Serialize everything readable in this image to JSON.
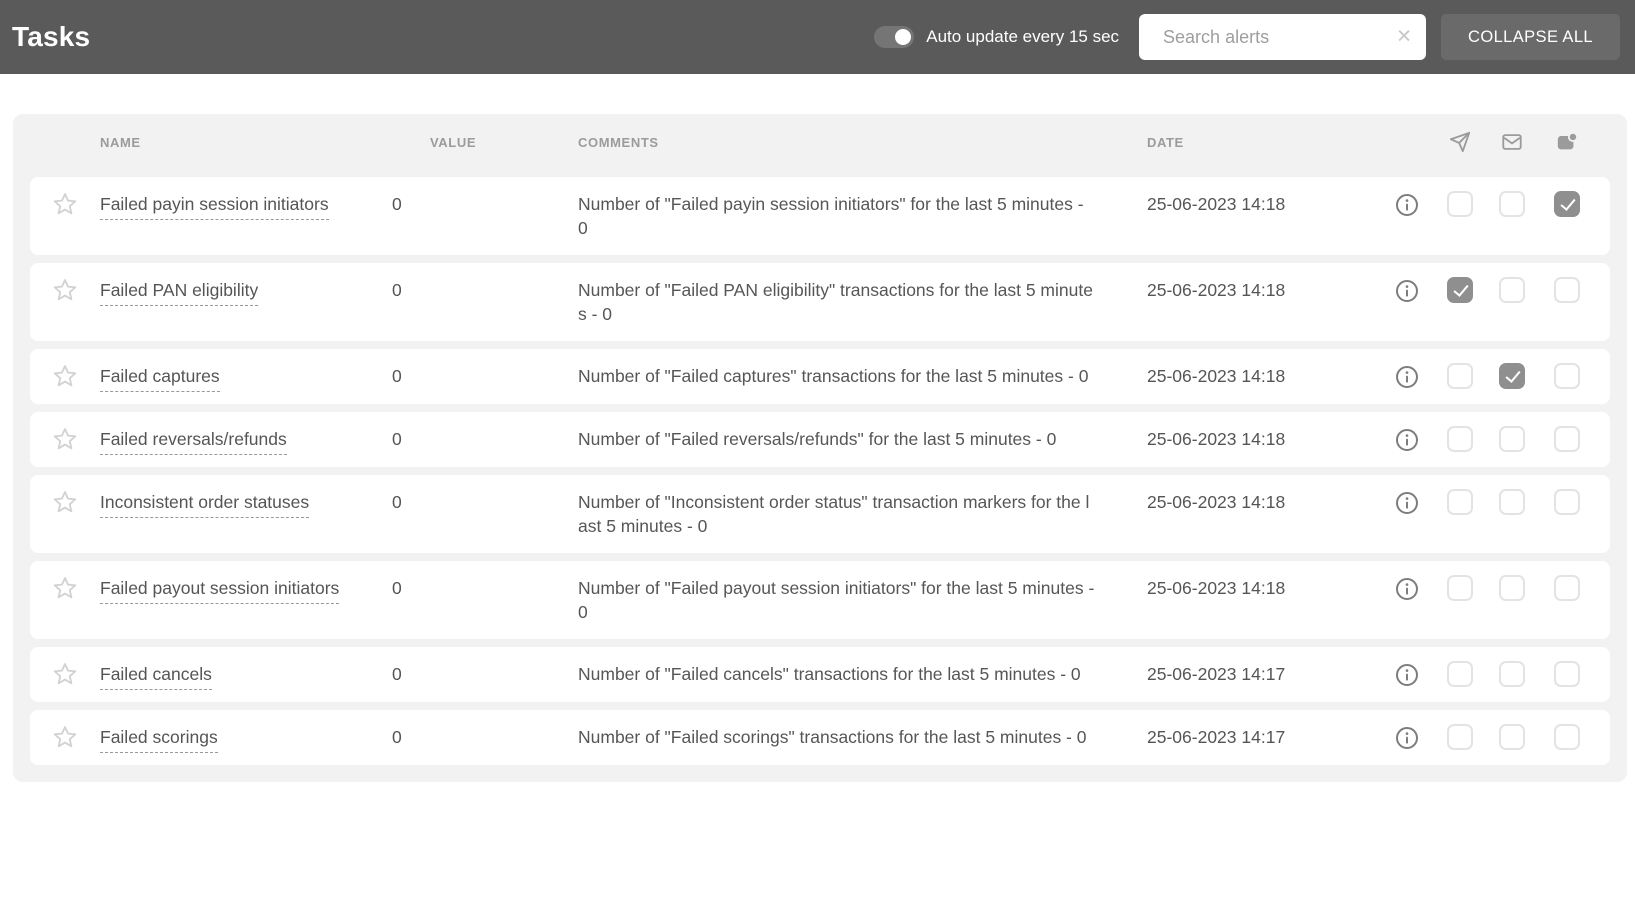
{
  "topbar": {
    "title": "Tasks",
    "auto_update": {
      "label": "Auto update every 15 sec",
      "enabled": true
    },
    "search": {
      "placeholder": "Search alerts",
      "value": "",
      "clear_icon": "✕"
    },
    "collapse_all_label": "COLLAPSE ALL"
  },
  "table": {
    "columns": {
      "name": "NAME",
      "value": "VALUE",
      "comments": "COMMENTS",
      "date": "DATE"
    },
    "channel_columns": [
      "telegram-icon",
      "email-icon",
      "contact-icon"
    ],
    "rows": [
      {
        "name": "Failed payin session initiators",
        "value": "0",
        "comment": "Number of \"Failed payin session initiators\" for the last 5 minutes - 0",
        "date": "25-06-2023 14:18",
        "favorite": false,
        "channels": {
          "telegram": false,
          "email": false,
          "contact": true
        }
      },
      {
        "name": "Failed PAN eligibility",
        "value": "0",
        "comment": "Number of \"Failed PAN eligibility\" transactions for the last 5 minutes - 0",
        "date": "25-06-2023 14:18",
        "favorite": false,
        "channels": {
          "telegram": true,
          "email": false,
          "contact": false
        }
      },
      {
        "name": "Failed captures",
        "value": "0",
        "comment": "Number of \"Failed captures\" transactions for the last 5 minutes - 0",
        "date": "25-06-2023 14:18",
        "favorite": false,
        "channels": {
          "telegram": false,
          "email": true,
          "contact": false
        }
      },
      {
        "name": "Failed reversals/refunds",
        "value": "0",
        "comment": "Number of \"Failed reversals/refunds\" for the last 5 minutes - 0",
        "date": "25-06-2023 14:18",
        "favorite": false,
        "channels": {
          "telegram": false,
          "email": false,
          "contact": false
        }
      },
      {
        "name": "Inconsistent order statuses",
        "value": "0",
        "comment": "Number of \"Inconsistent order status\" transaction markers for the last 5 minutes - 0",
        "date": "25-06-2023 14:18",
        "favorite": false,
        "channels": {
          "telegram": false,
          "email": false,
          "contact": false
        }
      },
      {
        "name": "Failed payout session initiators",
        "value": "0",
        "comment": "Number of \"Failed payout session initiators\" for the last 5 minutes - 0",
        "date": "25-06-2023 14:18",
        "favorite": false,
        "channels": {
          "telegram": false,
          "email": false,
          "contact": false
        }
      },
      {
        "name": "Failed cancels",
        "value": "0",
        "comment": "Number of \"Failed cancels\" transactions for the last 5 minutes - 0",
        "date": "25-06-2023 14:17",
        "favorite": false,
        "channels": {
          "telegram": false,
          "email": false,
          "contact": false
        }
      },
      {
        "name": "Failed scorings",
        "value": "0",
        "comment": "Number of \"Failed scorings\" transactions for the last 5 minutes - 0",
        "date": "25-06-2023 14:17",
        "favorite": false,
        "channels": {
          "telegram": false,
          "email": false,
          "contact": false
        }
      }
    ]
  },
  "colors": {
    "topbar_bg": "#5a5a5a",
    "button_bg": "#6a6a6a",
    "table_bg": "#f2f2f2",
    "row_bg": "#ffffff",
    "muted_text": "#9b9b9b",
    "body_text": "#555555",
    "checked_checkbox": "#8f8f8f"
  }
}
